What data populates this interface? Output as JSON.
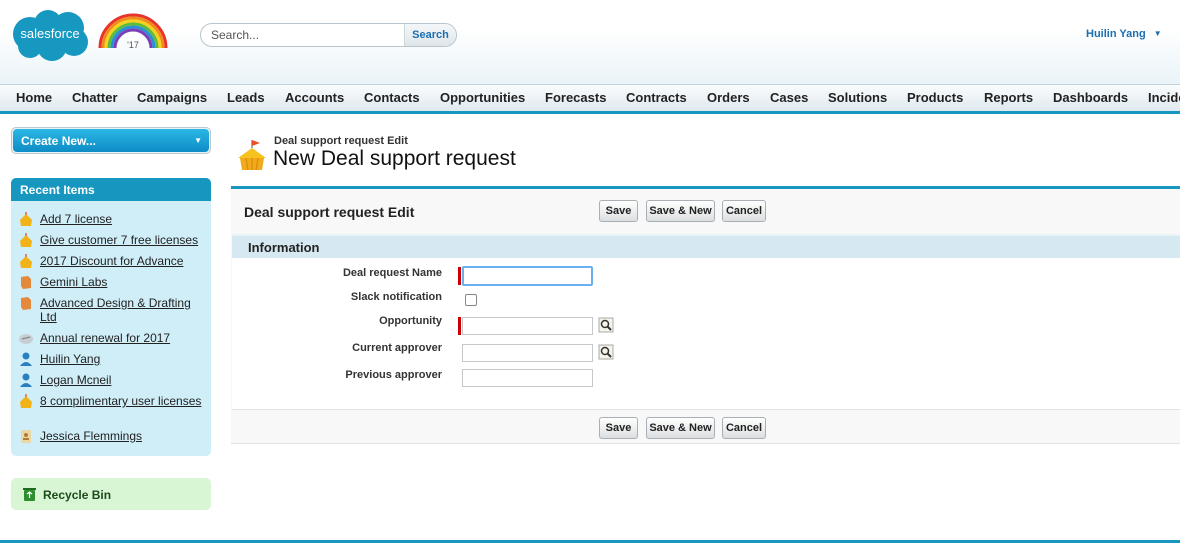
{
  "header": {
    "logo_text": "salesforce",
    "rainbow_text": "'17",
    "search": {
      "placeholder": "Search...",
      "button_label": "Search"
    },
    "user_name": "Huilin Yang"
  },
  "tabs": [
    "Home",
    "Chatter",
    "Campaigns",
    "Leads",
    "Accounts",
    "Contacts",
    "Opportunities",
    "Forecasts",
    "Contracts",
    "Orders",
    "Cases",
    "Solutions",
    "Products",
    "Reports",
    "Dashboards",
    "Incide"
  ],
  "sidebar": {
    "create_new_label": "Create New...",
    "recent_items_title": "Recent Items",
    "recent_items": [
      {
        "label": "Add 7 license",
        "icon": "custom-object-icon"
      },
      {
        "label": "Give customer 7 free licenses",
        "icon": "custom-object-icon"
      },
      {
        "label": "2017 Discount for Advance",
        "icon": "custom-object-icon"
      },
      {
        "label": "Gemini Labs",
        "icon": "account-icon"
      },
      {
        "label": "Advanced Design & Drafting Ltd",
        "icon": "account-icon"
      },
      {
        "label": "Annual renewal for 2017",
        "icon": "contract-icon"
      },
      {
        "label": "Huilin Yang",
        "icon": "user-icon"
      },
      {
        "label": "Logan Mcneil",
        "icon": "user-icon"
      },
      {
        "label": "8 complimentary user licenses",
        "icon": "custom-object-icon"
      },
      {
        "label": "Jessica Flemmings",
        "icon": "contact-card-icon"
      }
    ],
    "recycle_bin_label": "Recycle Bin"
  },
  "main": {
    "breadcrumb": "Deal support request Edit",
    "page_title": "New Deal support request",
    "form_title": "Deal support request Edit",
    "buttons": {
      "save": "Save",
      "save_new": "Save & New",
      "cancel": "Cancel"
    },
    "section_title": "Information",
    "fields": {
      "deal_request_name": {
        "label": "Deal request Name",
        "value": "",
        "required": true
      },
      "slack_notification": {
        "label": "Slack notification",
        "checked": false
      },
      "opportunity": {
        "label": "Opportunity",
        "value": "",
        "required": true
      },
      "current_approver": {
        "label": "Current approver",
        "value": ""
      },
      "previous_approver": {
        "label": "Previous approver",
        "value": ""
      }
    }
  },
  "colors": {
    "accent": "#1797c0",
    "link_blue": "#1b6fb1",
    "recent_bg": "#cfeef8",
    "recycle_bg": "#d8f5d4",
    "required_red": "#cc0000"
  }
}
